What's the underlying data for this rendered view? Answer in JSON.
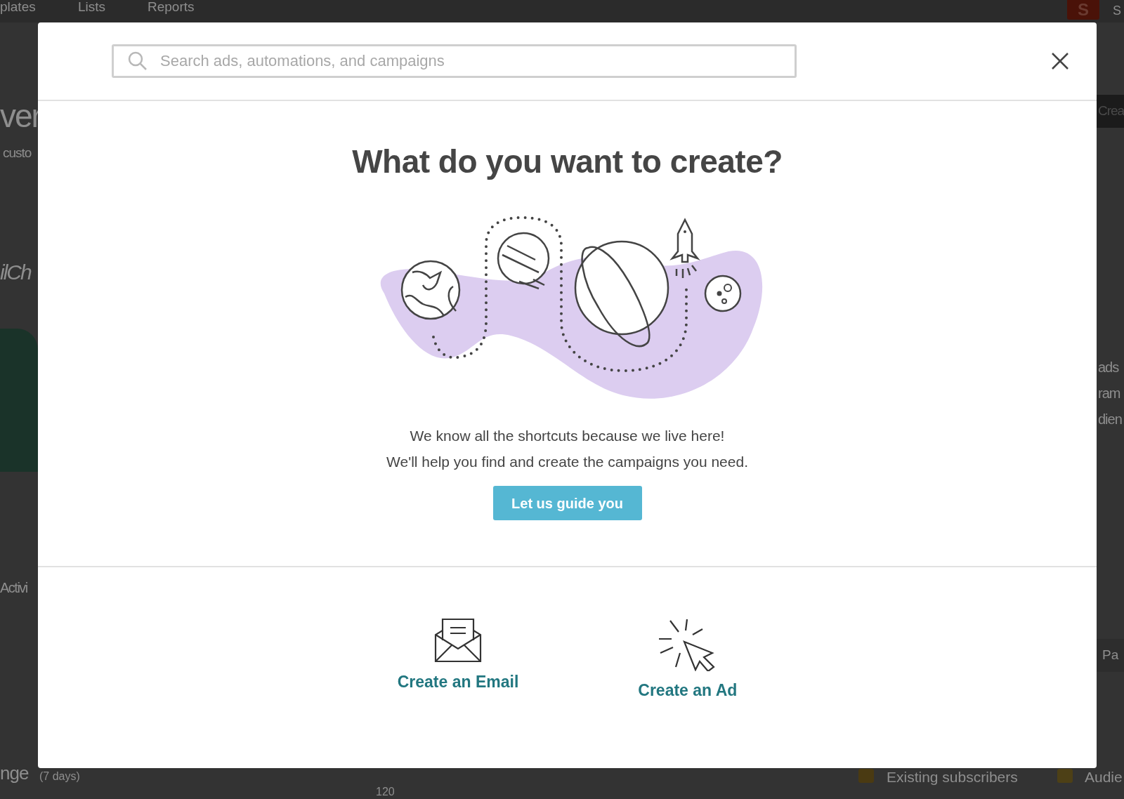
{
  "background_page": {
    "nav_items": [
      "plates",
      "Lists",
      "Reports"
    ],
    "avatar": "S",
    "account_initial": "S",
    "heading": "ver",
    "subtitle": "custo",
    "italic_text": "ilCh",
    "create_button": "Crea",
    "side_lines": [
      "ads",
      "ram",
      "dien"
    ],
    "tab": "Activi",
    "pager_button": "Pa",
    "chart_title": "nge",
    "chart_period": "(7 days)",
    "axis_label": "120",
    "legend": [
      {
        "label": "Existing subscribers",
        "color": "#4a3a12"
      },
      {
        "label": "Audie",
        "color": "#4d4016"
      }
    ]
  },
  "modal": {
    "search": {
      "placeholder": "Search ads, automations, and campaigns"
    },
    "title": "What do you want to create?",
    "message": [
      "We know all the shortcuts because we live here!",
      "We'll help you find and create the campaigns you need."
    ],
    "guide_button": "Let us guide you",
    "options": [
      {
        "kind": "email",
        "label": "Create an Email"
      },
      {
        "kind": "ad",
        "label": "Create an Ad"
      }
    ]
  }
}
